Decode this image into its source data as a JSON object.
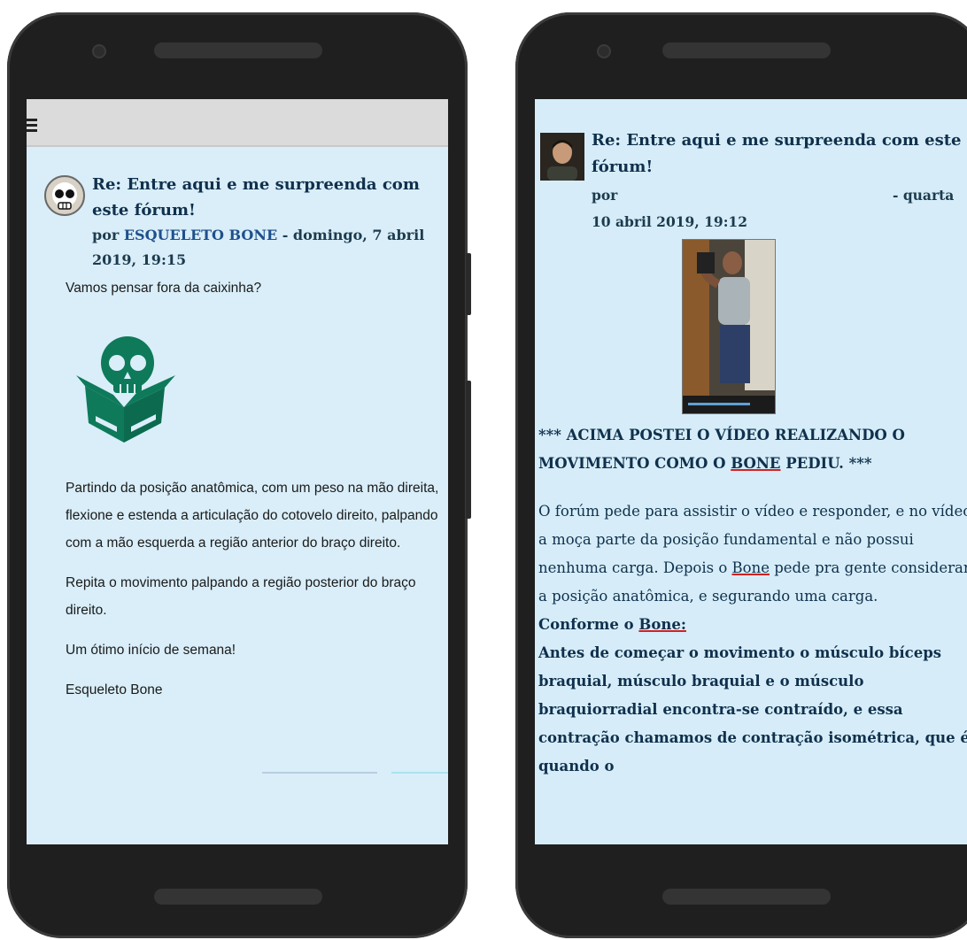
{
  "left_post": {
    "title": "Re: Entre aqui e me surpreenda com este fórum!",
    "by_prefix": "por ",
    "author": "ESQUELETO BONE",
    "date": " - domingo, 7 abril 2019, 19:15",
    "intro": "Vamos pensar fora da caixinha?",
    "paragraphs": [
      "Partindo da posição anatômica, com um peso na mão direita, flexione e estenda a articulação do cotovelo direito, palpando com a mão esquerda a região anterior do braço direito.",
      "Repita o movimento palpando a região posterior do braço direito.",
      "Um ótimo início de semana!",
      "Esqueleto Bone"
    ],
    "logo_color": "#0e7a5a"
  },
  "right_post": {
    "title": "Re: Entre aqui e me surpreenda com este fórum!",
    "by_label": "por",
    "date_suffix": "- quarta",
    "date_line": "10 abril 2019, 19:12",
    "notice_pre": "*** ACIMA POSTEI O VÍDEO REALIZANDO O MOVIMENTO COMO O ",
    "notice_name": "BONE",
    "notice_post": " PEDIU. ***",
    "para1_pre": "O forúm pede para assistir o vídeo e responder, e no vídeo a moça parte da posição fundamental e não possui nenhuma carga. Depois o ",
    "para1_name": "Bone",
    "para1_post": " pede pra gente considerar a posição anatômica, e segurando uma carga.",
    "conforme_pre": "Conforme o ",
    "conforme_name": "Bone:",
    "para2": "Antes de começar o movimento o músculo bíceps braquial, músculo braquial e o músculo braquiorradial encontra-se contraído, e essa contração chamamos de contração isométrica, que é quando o"
  },
  "colors": {
    "screen_bg": "#d9eef9",
    "title_color": "#10304c",
    "author_link": "#1f4f8c",
    "underline": "#d42020"
  }
}
